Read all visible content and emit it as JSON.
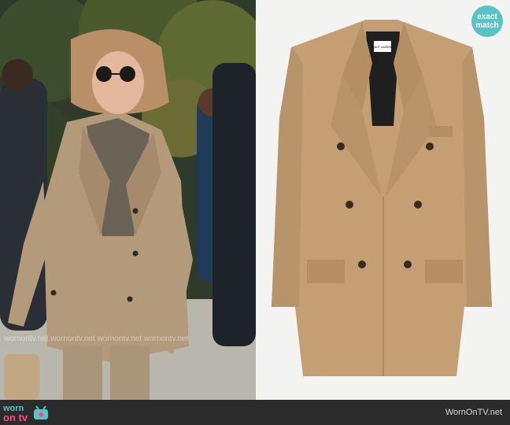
{
  "badge": {
    "line1": "exact",
    "line2": "match"
  },
  "watermark": {
    "text": "wornontv.net wornontv.net wornontv.net wornontv.net"
  },
  "footer": {
    "logo_line1": "worn",
    "logo_line2": "on tv",
    "site": "WornOnTV.net"
  },
  "jacket_label": {
    "brand": "SAINT LAURENT"
  },
  "colors": {
    "accent": "#5ac3c6",
    "pink": "#ff4b8a",
    "camel": "#c49f73",
    "bg_right": "#f3f3f2"
  }
}
